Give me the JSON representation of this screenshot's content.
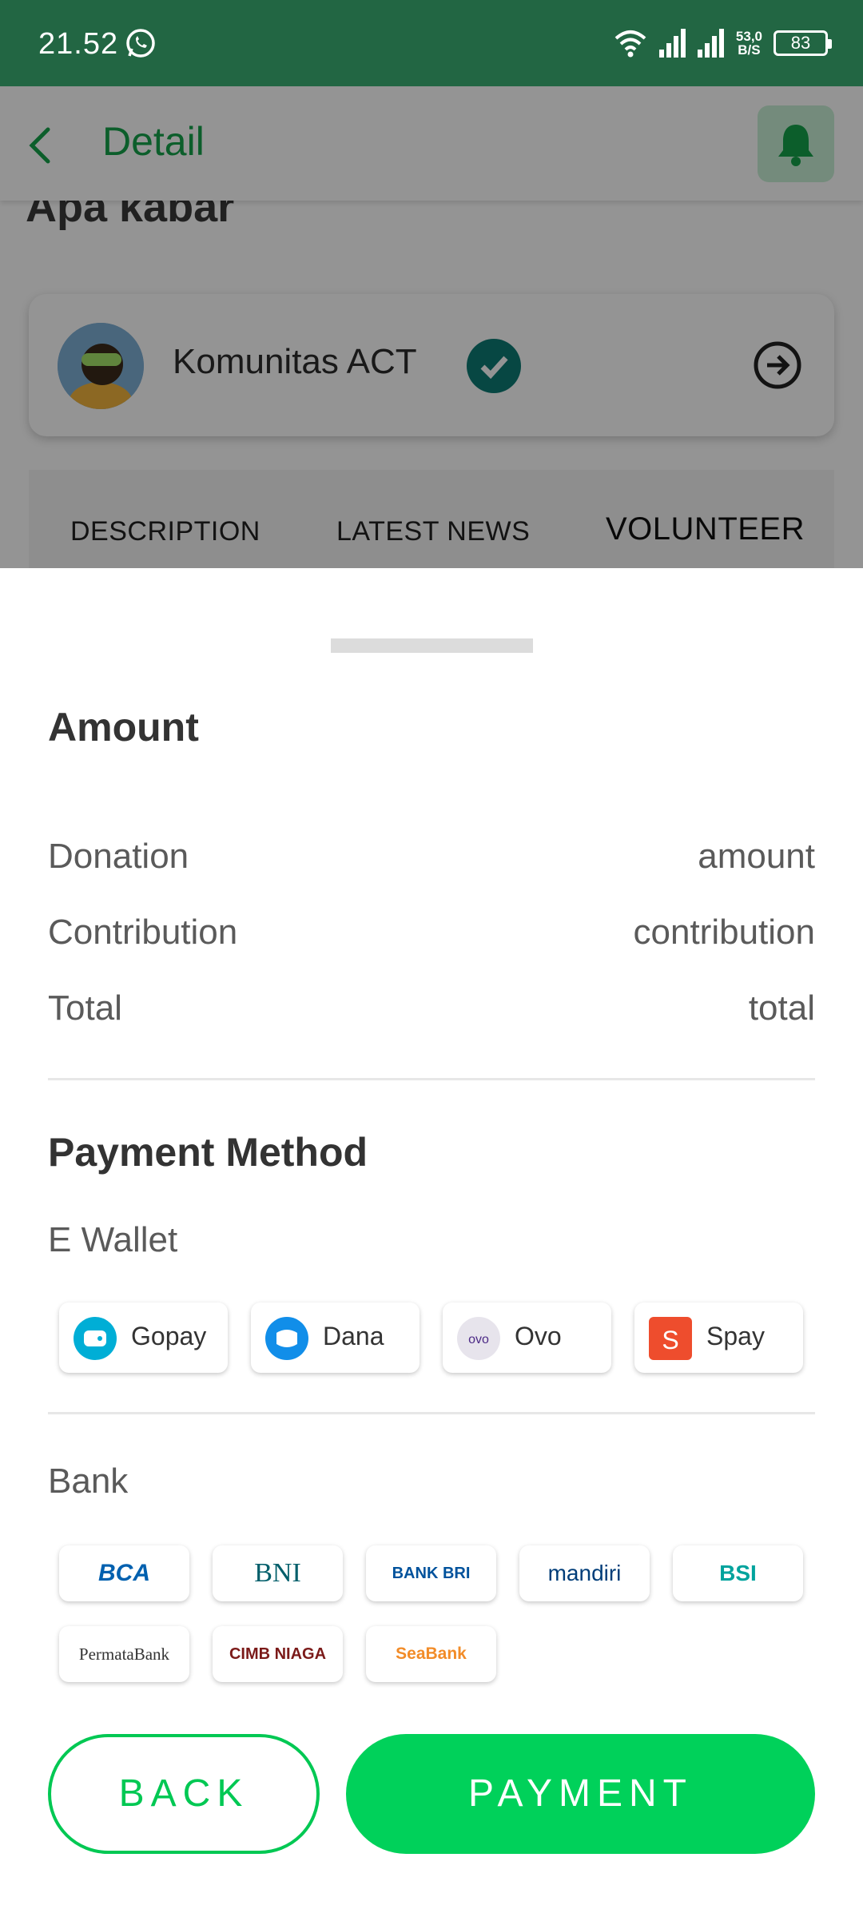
{
  "status_bar": {
    "time": "21.52",
    "net_speed_value": "53,0",
    "net_speed_unit": "B/S",
    "battery": "83"
  },
  "appbar": {
    "title": "Detail"
  },
  "background_page": {
    "partial_title": "Apa kabar",
    "organization": "Komunitas ACT",
    "tabs": [
      "DESCRIPTION",
      "LATEST NEWS",
      "VOLUNTEER"
    ],
    "active_tab": "VOLUNTEER"
  },
  "sheet": {
    "amount_title": "Amount",
    "rows": [
      {
        "label": "Donation",
        "value": "amount"
      },
      {
        "label": "Contribution",
        "value": "contribution"
      },
      {
        "label": "Total",
        "value": "total"
      }
    ],
    "payment_title": "Payment Method",
    "ewallet_title": "E Wallet",
    "wallets": [
      {
        "label": "Gopay",
        "icon": "gopay-icon",
        "color": "#00aed6"
      },
      {
        "label": "Dana",
        "icon": "dana-icon",
        "color": "#118ee9"
      },
      {
        "label": "Ovo",
        "icon": "ovo-icon",
        "color": "#4c2a86"
      },
      {
        "label": "Spay",
        "icon": "shopeepay-icon",
        "color": "#ee4d2d"
      }
    ],
    "bank_title": "Bank",
    "banks": [
      {
        "label": "BCA",
        "color": "#0060af"
      },
      {
        "label": "BNI",
        "color": "#f15a23"
      },
      {
        "label": "BANK BRI",
        "color": "#00529c"
      },
      {
        "label": "mandiri",
        "color": "#003d79"
      },
      {
        "label": "BSI",
        "color": "#00a39d"
      },
      {
        "label": "PermataBank",
        "color": "#333333"
      },
      {
        "label": "CIMB NIAGA",
        "color": "#7b1a19"
      },
      {
        "label": "SeaBank",
        "color": "#f28c28"
      }
    ],
    "back_label": "BACK",
    "payment_label": "PAYMENT"
  },
  "colors": {
    "primary_green": "#00d15a",
    "status_bar": "#226643"
  }
}
